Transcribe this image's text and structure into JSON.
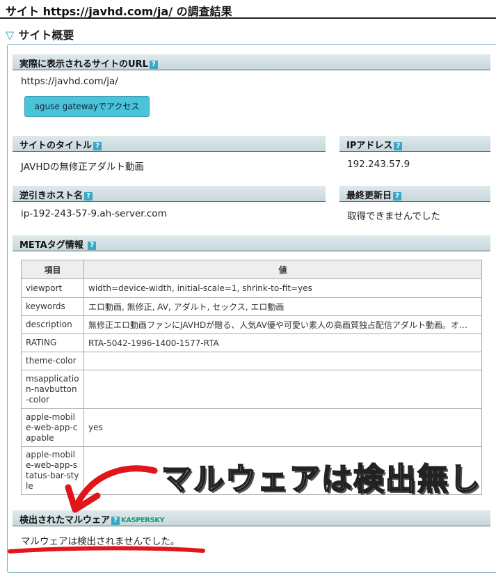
{
  "page_title": "サイト https://javhd.com/ja/ の調査結果",
  "section_title": "サイト概要",
  "url_header": "実際に表示されるサイトのURL",
  "url_value": "https://javhd.com/ja/",
  "gateway_button": "aguse gatewayでアクセス",
  "site_title_header": "サイトのタイトル",
  "site_title_value": "JAVHDの無修正アダルト動画",
  "ip_header": "IPアドレス",
  "ip_value": "192.243.57.9",
  "reverse_host_header": "逆引きホスト名",
  "reverse_host_value": "ip-192-243-57-9.ah-server.com",
  "last_updated_header": "最終更新日",
  "last_updated_value": "取得できませんでした",
  "meta_header": "METAタグ情報",
  "help_icon": "?",
  "meta_table": {
    "columns": [
      "項目",
      "値"
    ],
    "rows": [
      {
        "key": "viewport",
        "value": "width=device-width, initial-scale=1, shrink-to-fit=yes"
      },
      {
        "key": "keywords",
        "value": "エロ動画, 無修正, AV, アダルト, セックス, エロ動画"
      },
      {
        "key": "description",
        "value": "無修正エロ動画ファンにJAVHDが贈る、人気AV優や可愛い素人の高画質独占配信アダルト動画。オ…"
      },
      {
        "key": "RATING",
        "value": "RTA-5042-1996-1400-1577-RTA"
      },
      {
        "key": "theme-color",
        "value": ""
      },
      {
        "key": "msapplication-navbutton-color",
        "value": ""
      },
      {
        "key": "apple-mobile-web-app-capable",
        "value": "yes"
      },
      {
        "key": "apple-mobile-web-app-status-bar-style",
        "value": ""
      }
    ]
  },
  "malware_header": "検出されたマルウェア",
  "kaspersky_logo": "KASPERSKY",
  "malware_value": "マルウェアは検出されませんでした。",
  "overlay_caption": "マルウェアは検出無し",
  "annotation_color": "#e0161b"
}
